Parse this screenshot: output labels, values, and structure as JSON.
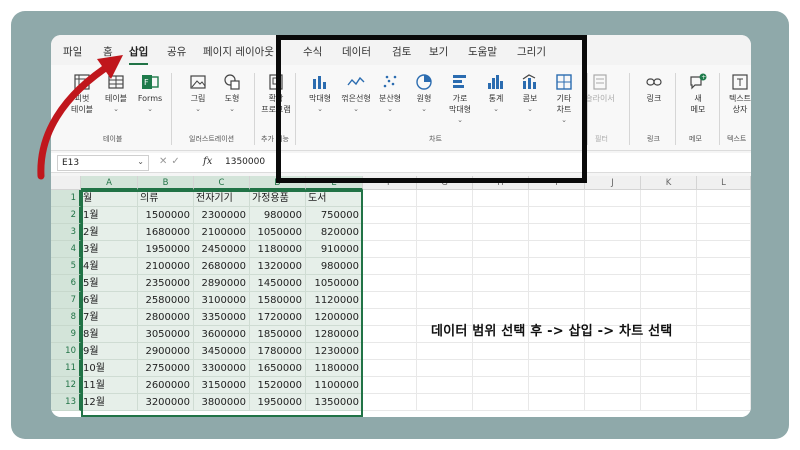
{
  "tabs": [
    "파일",
    "홈",
    "삽입",
    "공유",
    "페이지 레이아웃",
    "수식",
    "데이터",
    "검토",
    "보기",
    "도움말",
    "그리기"
  ],
  "active_tab": "삽입",
  "ribbon": {
    "pivot": "피벗\n테이블",
    "table": "테이블",
    "forms": "Forms",
    "group_table": "테이블",
    "picture": "그림",
    "shapes": "도형",
    "group_illust": "일러스트레이션",
    "addins": "확장\n프로그램",
    "group_addins": "추가 기능",
    "bar": "막대형",
    "line": "꺾은선형",
    "scatter": "분산형",
    "pie": "원형",
    "hbar": "가로\n막대형",
    "stat": "통계",
    "combo": "콤보",
    "other": "기타\n차트",
    "group_chart": "차트",
    "slicer": "슬라이서",
    "group_filter": "필터",
    "link": "링크",
    "group_link": "링크",
    "memo": "새\n메모",
    "group_memo": "메모",
    "textbox": "텍스트\n상자",
    "group_text": "텍스트"
  },
  "formula_bar": {
    "name_box": "E13",
    "value": "1350000"
  },
  "columns": [
    "A",
    "B",
    "C",
    "D",
    "E",
    "F",
    "G",
    "H",
    "I",
    "J",
    "K",
    "L"
  ],
  "rows": [
    [
      "월",
      "의류",
      "전자기기",
      "가정용품",
      "도서"
    ],
    [
      "1월",
      "1500000",
      "2300000",
      "980000",
      "750000"
    ],
    [
      "2월",
      "1680000",
      "2100000",
      "1050000",
      "820000"
    ],
    [
      "3월",
      "1950000",
      "2450000",
      "1180000",
      "910000"
    ],
    [
      "4월",
      "2100000",
      "2680000",
      "1320000",
      "980000"
    ],
    [
      "5월",
      "2350000",
      "2890000",
      "1450000",
      "1050000"
    ],
    [
      "6월",
      "2580000",
      "3100000",
      "1580000",
      "1120000"
    ],
    [
      "7월",
      "2800000",
      "3350000",
      "1720000",
      "1200000"
    ],
    [
      "8월",
      "3050000",
      "3600000",
      "1850000",
      "1280000"
    ],
    [
      "9월",
      "2900000",
      "3450000",
      "1780000",
      "1230000"
    ],
    [
      "10월",
      "2750000",
      "3300000",
      "1650000",
      "1180000"
    ],
    [
      "11월",
      "2600000",
      "3150000",
      "1520000",
      "1100000"
    ],
    [
      "12월",
      "3200000",
      "3800000",
      "1950000",
      "1350000"
    ]
  ],
  "row_numbers": [
    "1",
    "2",
    "3",
    "4",
    "5",
    "6",
    "7",
    "8",
    "9",
    "10",
    "11",
    "12",
    "13"
  ],
  "annotation": "데이터 범위 선택 후 -> 삽입 -> 차트 선택",
  "colors": {
    "excel_green": "#217346",
    "frame": "#8fa9aa",
    "arrow": "#c0161c"
  }
}
